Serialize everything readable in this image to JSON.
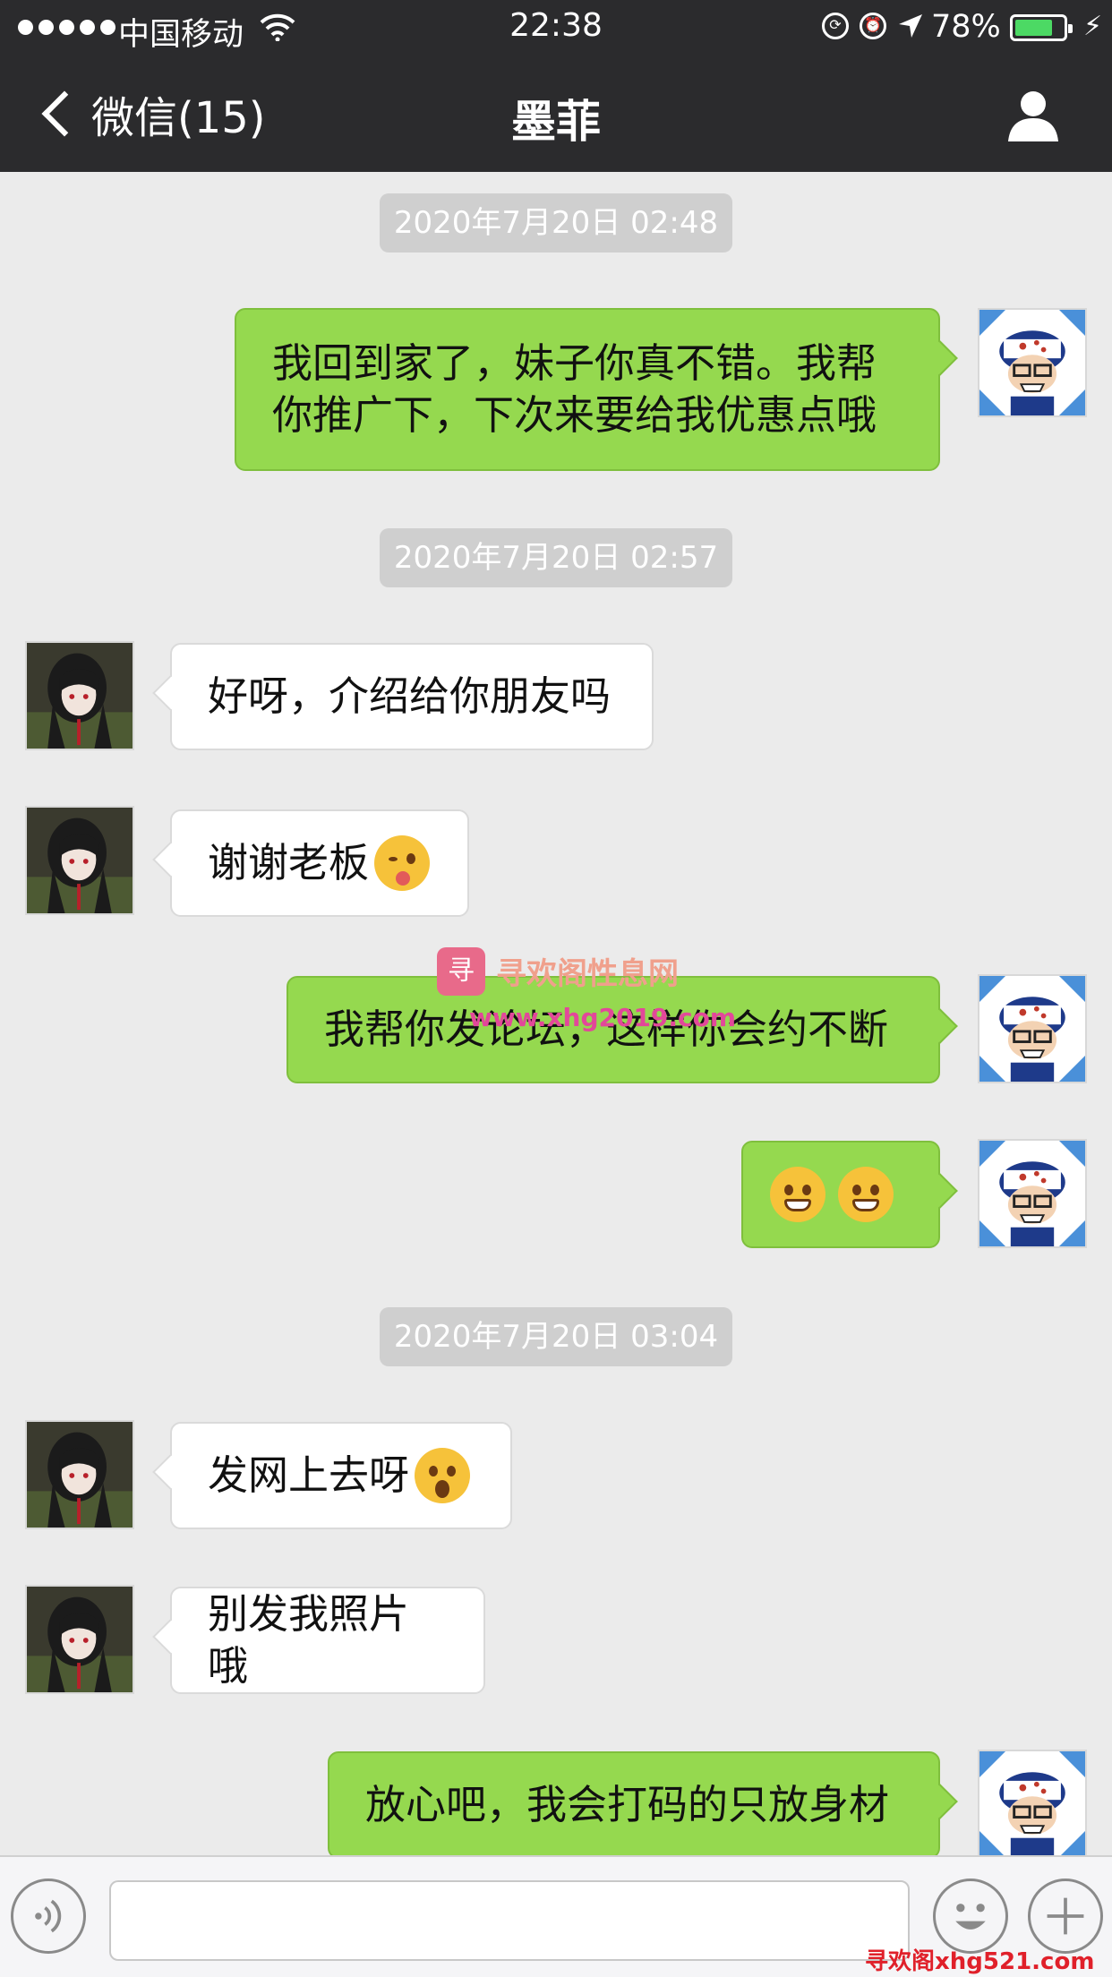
{
  "status_bar": {
    "carrier": "中国移动",
    "time": "22:38",
    "battery": "78%",
    "battery_level": 0.78
  },
  "nav": {
    "back_label": "微信(15)",
    "title": "墨菲"
  },
  "messages": [
    {
      "type": "timestamp",
      "text": "2020年7月20日 02:48"
    },
    {
      "type": "out",
      "lines": [
        "我回到家了，妹子你真不错。我帮",
        "你推广下，下次来要给我优惠点哦"
      ]
    },
    {
      "type": "timestamp",
      "text": "2020年7月20日 02:57"
    },
    {
      "type": "in",
      "text": "好呀，介绍给你朋友吗"
    },
    {
      "type": "in",
      "text": "谢谢老板",
      "emoji": "wink-tongue-emoji"
    },
    {
      "type": "out",
      "text": "我帮你发论坛，这样你会约不断"
    },
    {
      "type": "out",
      "emoji": "grin-emoji x2"
    },
    {
      "type": "timestamp",
      "text": "2020年7月20日 03:04"
    },
    {
      "type": "in",
      "text": "发网上去呀",
      "emoji": "surprised-emoji"
    },
    {
      "type": "in",
      "text": "别发我照片哦"
    },
    {
      "type": "out",
      "text": "放心吧，我会打码的只放身材"
    }
  ],
  "watermark": {
    "title": "寻欢阁性息网",
    "url": "www.xhg2019.com"
  },
  "corner_watermark": "寻欢阁xhg521.com"
}
